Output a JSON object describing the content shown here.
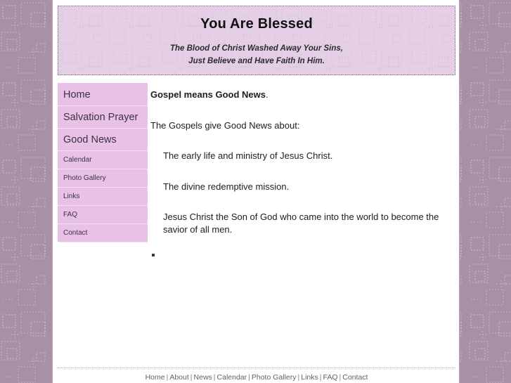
{
  "site": {
    "title": "You Are Blessed",
    "tagline_line1": "The Blood of Christ Washed Away Your Sins,",
    "tagline_line2": "Just Believe and Have Faith In Him."
  },
  "colors": {
    "page_background": "#a890a9",
    "banner_background": "#e4cfe7",
    "sidebar_background": "#e9c0e6",
    "content_background": "#ffffff",
    "title_text": "#111111",
    "body_text": "#1d1d1d",
    "nav_text": "#3c3340",
    "footer_text": "#6b5b6b"
  },
  "sidebar": {
    "items": [
      {
        "label": "Home",
        "size": "big"
      },
      {
        "label": "Salvation Prayer",
        "size": "big"
      },
      {
        "label": "Good News",
        "size": "big"
      },
      {
        "label": "Calendar",
        "size": "small"
      },
      {
        "label": "Photo Gallery",
        "size": "small"
      },
      {
        "label": "Links",
        "size": "small"
      },
      {
        "label": "FAQ",
        "size": "small"
      },
      {
        "label": "Contact",
        "size": "small"
      }
    ]
  },
  "content": {
    "lead_bold": "Gospel means Good News",
    "lead_punct": ".",
    "intro": "The Gospels give Good News about:",
    "points": [
      "The early life and ministry of Jesus Christ.",
      "The divine redemptive mission.",
      "Jesus Christ the Son of God who came into the world to become the savior of all men."
    ],
    "trailing_bullet": "▪"
  },
  "footer": {
    "separator": "|",
    "links": [
      "Home",
      "About",
      "News",
      "Calendar",
      "Photo Gallery",
      "Links",
      "FAQ",
      "Contact"
    ]
  }
}
